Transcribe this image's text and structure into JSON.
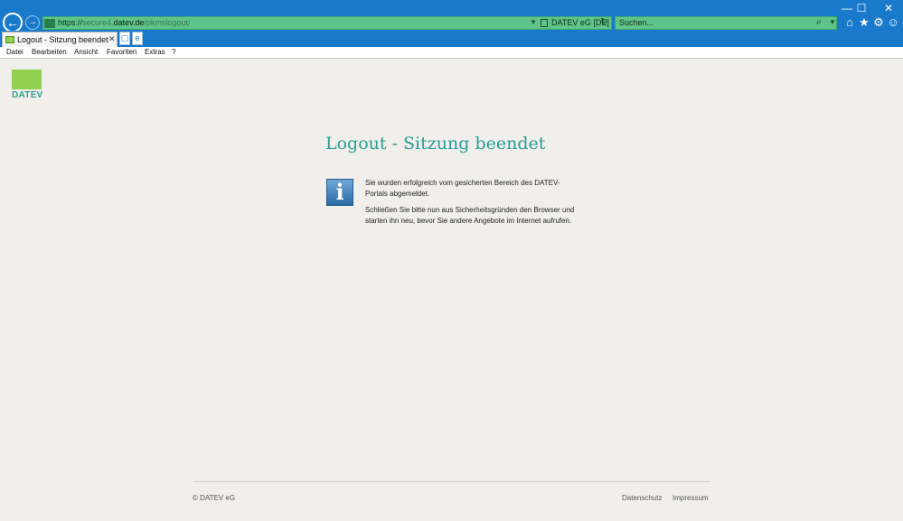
{
  "browser": {
    "address": {
      "scheme": "https://",
      "subdomain": "secure4.",
      "domain": "datev.de",
      "path": "/pkmslogout/",
      "cert_owner": "DATEV eG [DE]"
    },
    "search": {
      "placeholder": "Suchen..."
    },
    "tab": {
      "title": "Logout - Sitzung beendet"
    },
    "window_controls": {
      "minimize": "—",
      "maximize": "☐",
      "close": "✕"
    },
    "tool_icons": [
      "home-icon",
      "star-icon",
      "gear-icon",
      "smiley-icon"
    ]
  },
  "menubar": {
    "items": [
      "Datei",
      "Bearbeiten",
      "Ansicht",
      "Favoriten",
      "Extras",
      "?"
    ]
  },
  "page": {
    "logo_text": "DATEV",
    "heading": "Logout - Sitzung beendet",
    "message_1": "Sie wurden erfolgreich vom gesicherten Bereich des DATEV-Portals abgemeldet.",
    "message_2": "Schließen Sie bitte nun aus Sicherheitsgründen den Browser und starten ihn neu, bevor Sie andere Angebote im Internet aufrufen.",
    "footer": {
      "copyright": "© DATEV eG",
      "links": [
        "Datenschutz",
        "Impressum"
      ]
    }
  },
  "colors": {
    "chrome_blue": "#1979ca",
    "address_green": "#5fc48a",
    "logo_green": "#92d050",
    "heading_teal": "#2a9d93"
  }
}
